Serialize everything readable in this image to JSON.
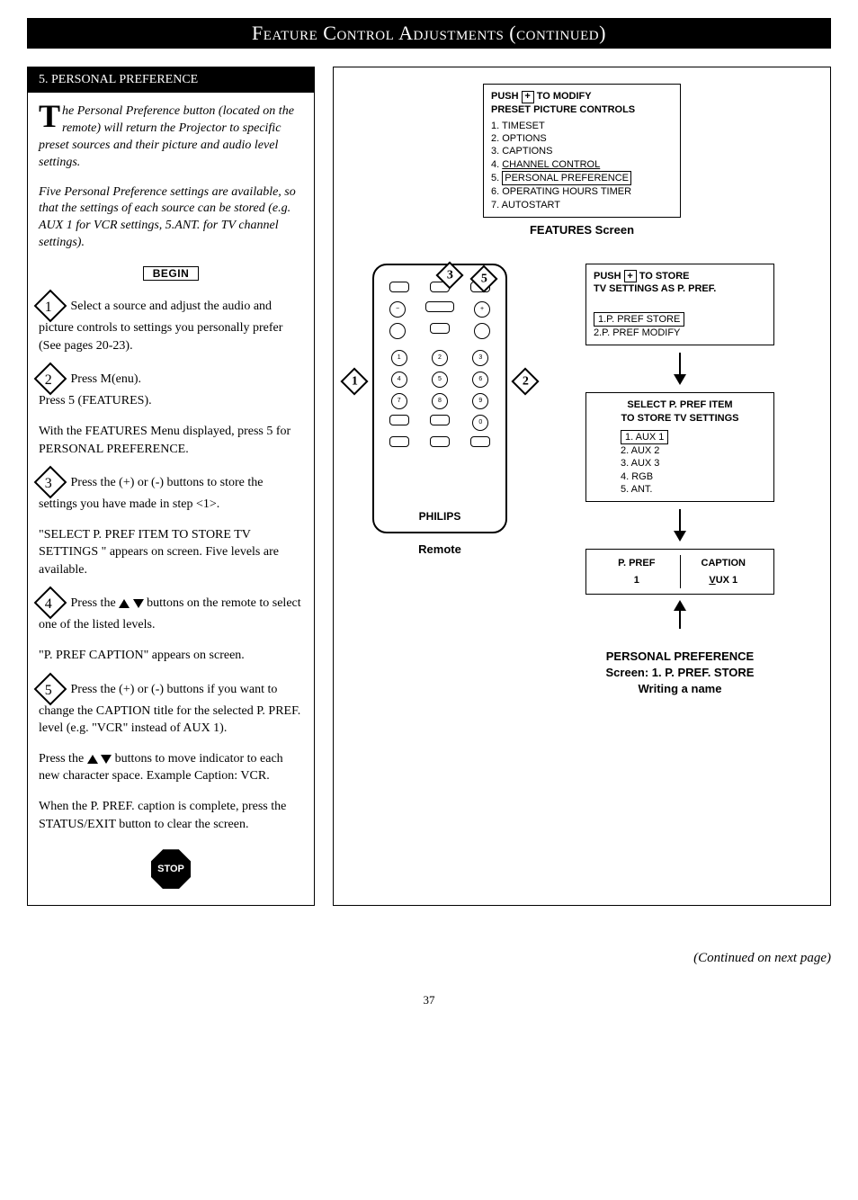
{
  "header": {
    "title": "Feature Control Adjustments (continued)"
  },
  "section": {
    "number": "5.",
    "title": "PERSONAL PREFERENCE"
  },
  "intro": {
    "dropcap": "T",
    "text1": "he Personal Preference button (located on the remote) will return the Projector to specific preset sources and their picture and audio level settings.",
    "text2": "Five Personal Preference settings are available, so that the settings of each source can be stored (e.g. AUX 1 for VCR settings, 5.ANT. for TV channel settings)."
  },
  "begin": "BEGIN",
  "steps": {
    "s1": {
      "num": "1",
      "text": "Select a source and adjust the audio and picture controls to settings you personally prefer (See pages 20-23)."
    },
    "s2": {
      "num": "2",
      "line1": "Press M(enu).",
      "line2": "Press 5 (FEATURES)."
    },
    "s2b": "With the FEATURES Menu displayed, press 5 for PERSONAL PREFERENCE.",
    "s3": {
      "num": "3",
      "text": "Press the (+) or (-) buttons to store the settings you have made in step <1>."
    },
    "s3b": "\"SELECT P. PREF ITEM TO STORE TV SETTINGS \" appears on screen. Five levels are available.",
    "s4": {
      "num": "4",
      "text_before": "Press the ",
      "text_after": " buttons on the remote to select one of the listed levels."
    },
    "s4b": "\"P. PREF CAPTION\" appears on screen.",
    "s5": {
      "num": "5",
      "text": "Press the (+) or (-) buttons if you want to change the CAPTION title for the selected P. PREF. level (e.g. \"VCR\" instead of AUX 1)."
    },
    "s5b_before": "Press the ",
    "s5b_after": " buttons to move indicator to each new character space. Example Caption: VCR.",
    "s5c": "When the P. PREF. caption is complete, press the STATUS/EXIT button to clear the screen."
  },
  "stop": "STOP",
  "features_screen": {
    "push_line": "PUSH",
    "push_after": "TO MODIFY",
    "sub": "PRESET PICTURE CONTROLS",
    "items": {
      "i1": "1. TIMESET",
      "i2": "2. OPTIONS",
      "i3": "3. CAPTIONS",
      "i4": "4. CHANNEL CONTROL",
      "i5": "5. PERSONAL PREFERENCE",
      "i6": "6. OPERATING HOURS TIMER",
      "i7": "7. AUTOSTART"
    },
    "label": "FEATURES Screen"
  },
  "store_screen": {
    "push_line": "PUSH",
    "push_after": "TO STORE",
    "sub": "TV SETTINGS AS P. PREF.",
    "opt1": "1.P. PREF STORE",
    "opt2": "2.P. PREF MODIFY"
  },
  "select_screen": {
    "line1": "SELECT P. PREF ITEM",
    "line2": "TO STORE TV SETTINGS",
    "items": {
      "i1": "1. AUX 1",
      "i2": "2. AUX 2",
      "i3": "3. AUX 3",
      "i4": "4. RGB",
      "i5": "5. ANT."
    }
  },
  "caption_screen": {
    "h1": "P. PREF",
    "h2": "CAPTION",
    "v1": "1",
    "v2": "VUX 1"
  },
  "remote": {
    "brand": "PHILIPS",
    "label": "Remote",
    "callouts": {
      "c1": "1",
      "c2": "2",
      "c3": "3",
      "c5": "5"
    }
  },
  "pp_caption": {
    "l1": "PERSONAL PREFERENCE",
    "l2": "Screen: 1. P. PREF. STORE",
    "l3": "Writing a name"
  },
  "footer": "(Continued on next page)",
  "page_num": "37"
}
